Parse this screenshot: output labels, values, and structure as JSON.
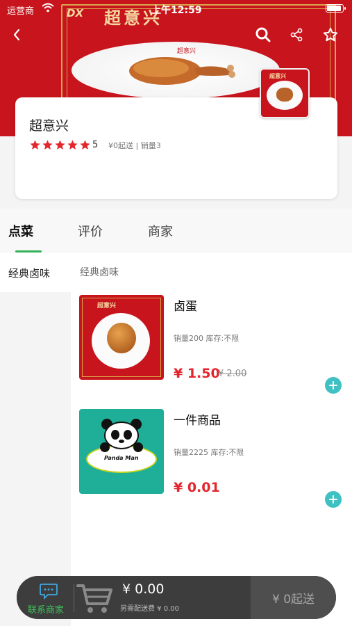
{
  "status_bar": {
    "carrier": "运营商",
    "time": "上午12:59",
    "battery_level": 0.9
  },
  "banner": {
    "brand": "超意兴",
    "logo_text": "超意兴",
    "logo_icon": "brand-logo-icon",
    "image": "braised-chicken-leg"
  },
  "nav": {
    "back_icon": "chevron-left-icon",
    "search_icon": "search-icon",
    "share_icon": "share-icon",
    "favorite_icon": "star-outline-icon"
  },
  "shop": {
    "name": "超意兴",
    "rating": "5",
    "stars": 5,
    "meta": "¥0起送 | 销量3",
    "logo_text": "超意兴"
  },
  "tabs": [
    {
      "label": "点菜",
      "active": true
    },
    {
      "label": "评价",
      "active": false
    },
    {
      "label": "商家",
      "active": false
    }
  ],
  "categories": [
    {
      "label": "经典卤味",
      "active": true
    }
  ],
  "section_title": "经典卤味",
  "products": [
    {
      "name": "卤蛋",
      "meta": "销量200 库存:不限",
      "price": "¥ 1.50",
      "original_price": "¥ 2.00",
      "image_brand": "超意兴"
    },
    {
      "name": "一件商品",
      "meta": "销量2225 库存:不限",
      "price": "¥ 0.01",
      "original_price": "",
      "image_text": "Panda Man"
    }
  ],
  "cart": {
    "contact_label": "联系商家",
    "total": "¥ 0.00",
    "delivery_fee": "另需配送费 ¥ 0.00",
    "checkout_label": "¥ 0起送"
  },
  "colors": {
    "brand_red": "#c8141c",
    "accent_green": "#32b25a",
    "price_red": "#e3262d",
    "add_button": "#3fc0c3"
  }
}
